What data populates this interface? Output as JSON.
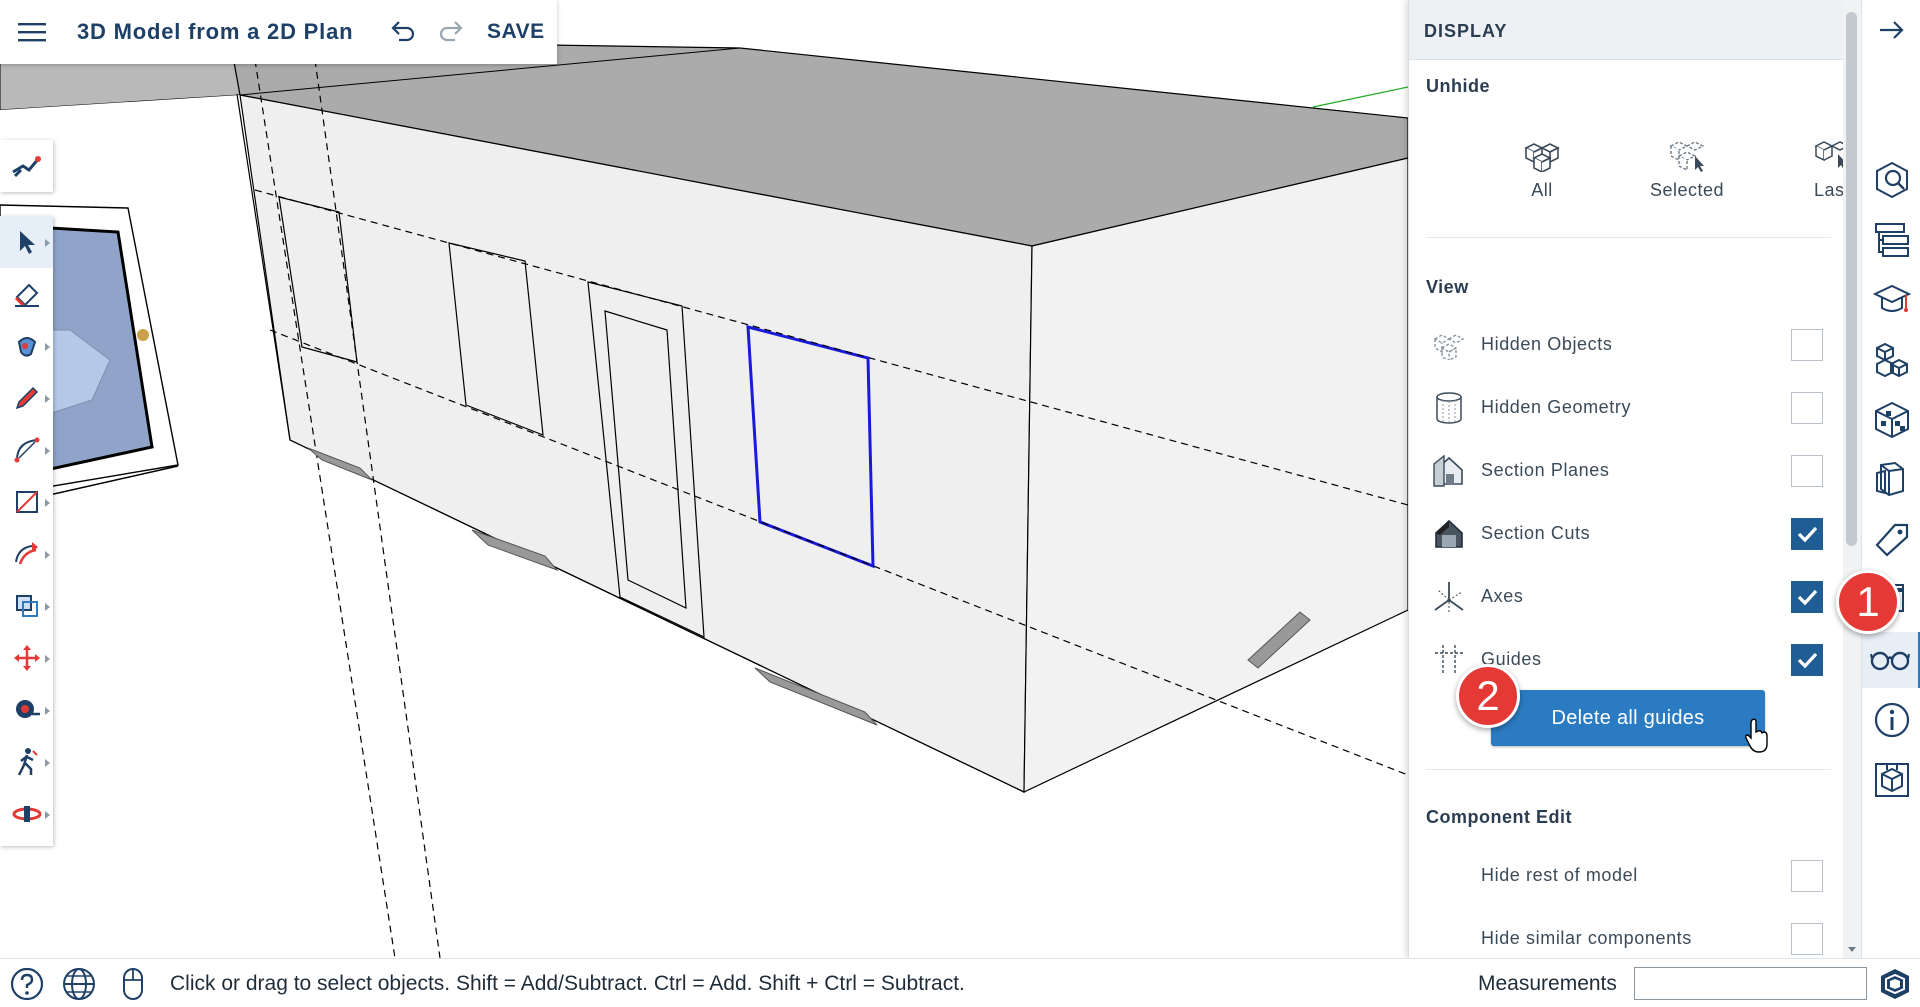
{
  "app": {
    "title": "3D Model from a 2D Plan",
    "save_label": "SAVE"
  },
  "icons": {
    "menu": "hamburger-menu-icon",
    "undo": "undo-icon",
    "redo": "redo-icon"
  },
  "left_toolbar": {
    "top": [
      {
        "name": "search-tool-icon"
      }
    ],
    "tools": [
      {
        "name": "select-tool",
        "active": true
      },
      {
        "name": "eraser-tool"
      },
      {
        "name": "paint-bucket-tool"
      },
      {
        "name": "pencil-line-tool"
      },
      {
        "name": "arc-tool"
      },
      {
        "name": "rectangle-tool"
      },
      {
        "name": "push-pull-tool"
      },
      {
        "name": "offset-tool"
      },
      {
        "name": "move-tool"
      },
      {
        "name": "tape-measure-tool"
      },
      {
        "name": "walk-tool"
      },
      {
        "name": "orbit-tool"
      }
    ]
  },
  "panel": {
    "title": "DISPLAY",
    "unhide": {
      "heading": "Unhide",
      "buttons": [
        {
          "label": "All"
        },
        {
          "label": "Selected"
        },
        {
          "label": "Last"
        }
      ]
    },
    "view": {
      "heading": "View",
      "options": [
        {
          "label": "Hidden Objects",
          "checked": false
        },
        {
          "label": "Hidden Geometry",
          "checked": false
        },
        {
          "label": "Section Planes",
          "checked": false
        },
        {
          "label": "Section Cuts",
          "checked": true
        },
        {
          "label": "Axes",
          "checked": true
        },
        {
          "label": "Guides",
          "checked": true
        }
      ],
      "delete_guides_label": "Delete all guides"
    },
    "component_edit": {
      "heading": "Component Edit",
      "options": [
        {
          "label": "Hide rest of model",
          "checked": false
        },
        {
          "label": "Hide similar components",
          "checked": false
        }
      ]
    }
  },
  "right_bar": {
    "close_icon": "arrow-right-icon",
    "items": [
      {
        "name": "model-info-icon"
      },
      {
        "name": "outliner-icon"
      },
      {
        "name": "instructor-icon"
      },
      {
        "name": "components-icon"
      },
      {
        "name": "materials-icon"
      },
      {
        "name": "styles-icon"
      },
      {
        "name": "tags-icon"
      },
      {
        "name": "scenes-icon"
      },
      {
        "name": "display-icon",
        "active": true
      },
      {
        "name": "entity-info-icon"
      },
      {
        "name": "solid-inspector-icon"
      }
    ]
  },
  "callouts": [
    "1",
    "2"
  ],
  "status_bar": {
    "message": "Click or drag to select objects. Shift = Add/Subtract. Ctrl = Add. Shift + Ctrl = Subtract.",
    "measurements_label": "Measurements",
    "measurements_value": ""
  },
  "colors": {
    "accent": "#2b7bc2",
    "title": "#1e4066",
    "checkbox_checked": "#1f5d94",
    "callout": "#e53935",
    "selected_edge": "#1a1adb"
  }
}
